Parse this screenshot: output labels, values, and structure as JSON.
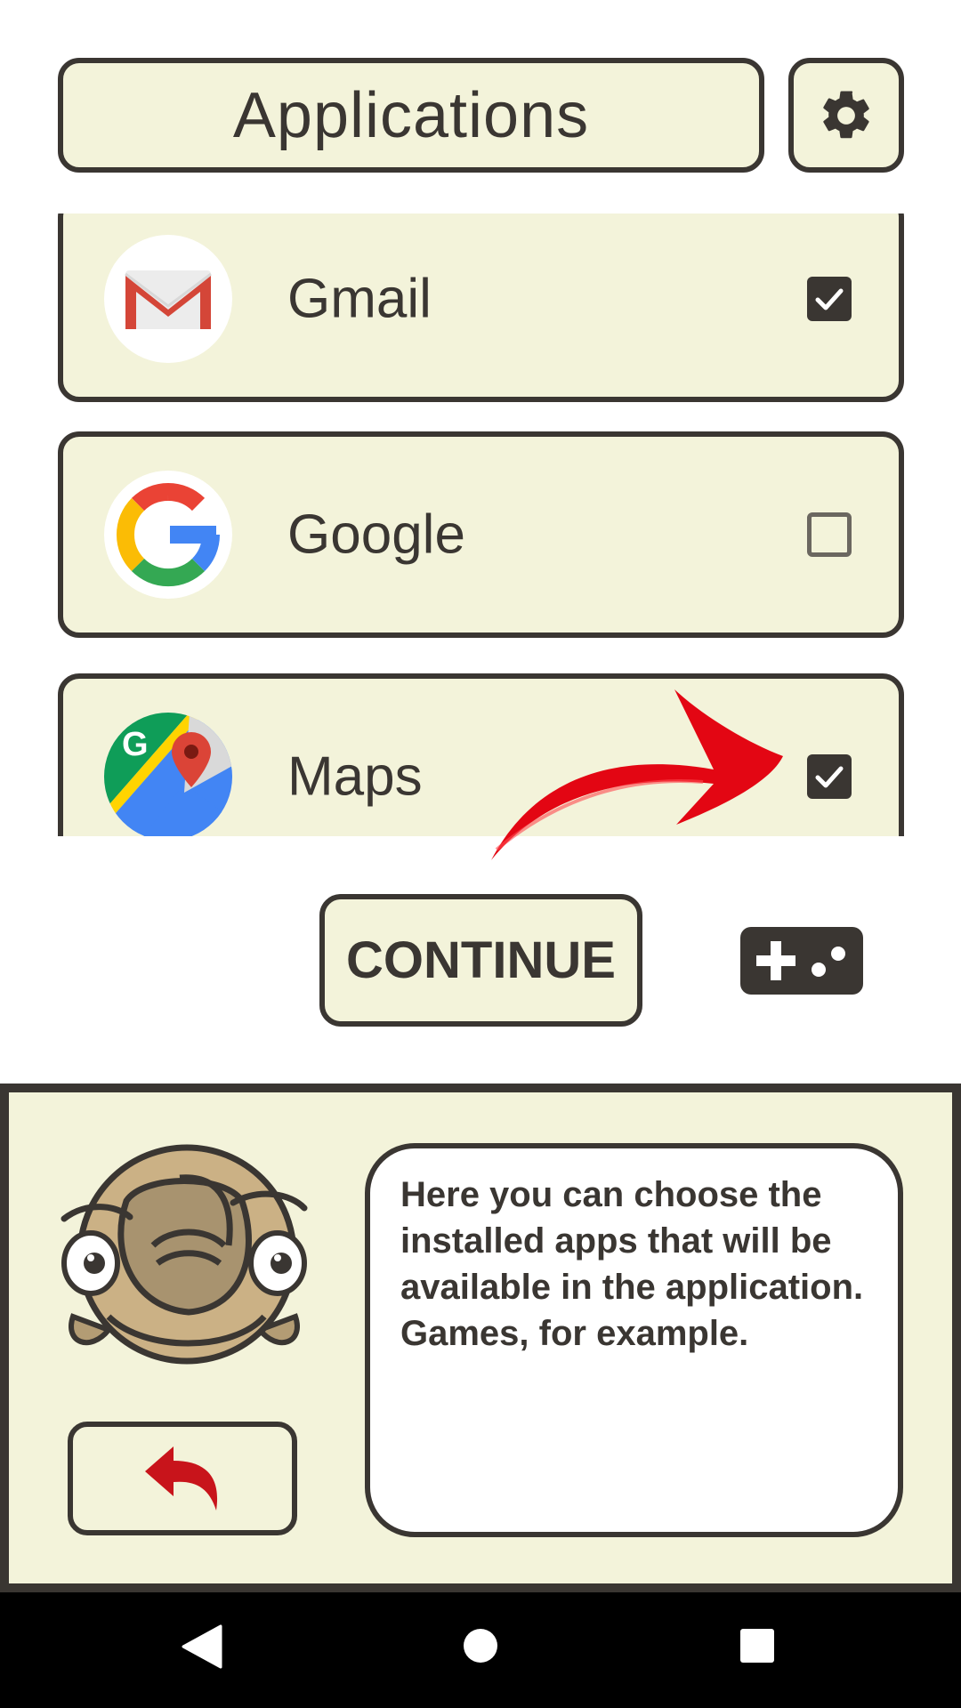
{
  "header": {
    "title": "Applications",
    "settings_icon": "gear-icon"
  },
  "apps": [
    {
      "name": "Gmail",
      "icon": "gmail-icon",
      "checked": true
    },
    {
      "name": "Google",
      "icon": "google-icon",
      "checked": false
    },
    {
      "name": "Maps",
      "icon": "maps-icon",
      "checked": true
    }
  ],
  "continue_label": "CONTINUE",
  "gamepad_icon": "gamepad-icon",
  "back_icon": "undo-arrow-icon",
  "hint_text": "Here you can choose the installed apps that will be available in the application. Games, for example.",
  "navbar": {
    "back_icon": "nav-back-icon",
    "home_icon": "nav-home-icon",
    "recents_icon": "nav-recents-icon"
  },
  "colors": {
    "panel": "#f3f3da",
    "outline": "#3a3632",
    "arrow": "#e30613",
    "back_arrow": "#c8141b"
  }
}
